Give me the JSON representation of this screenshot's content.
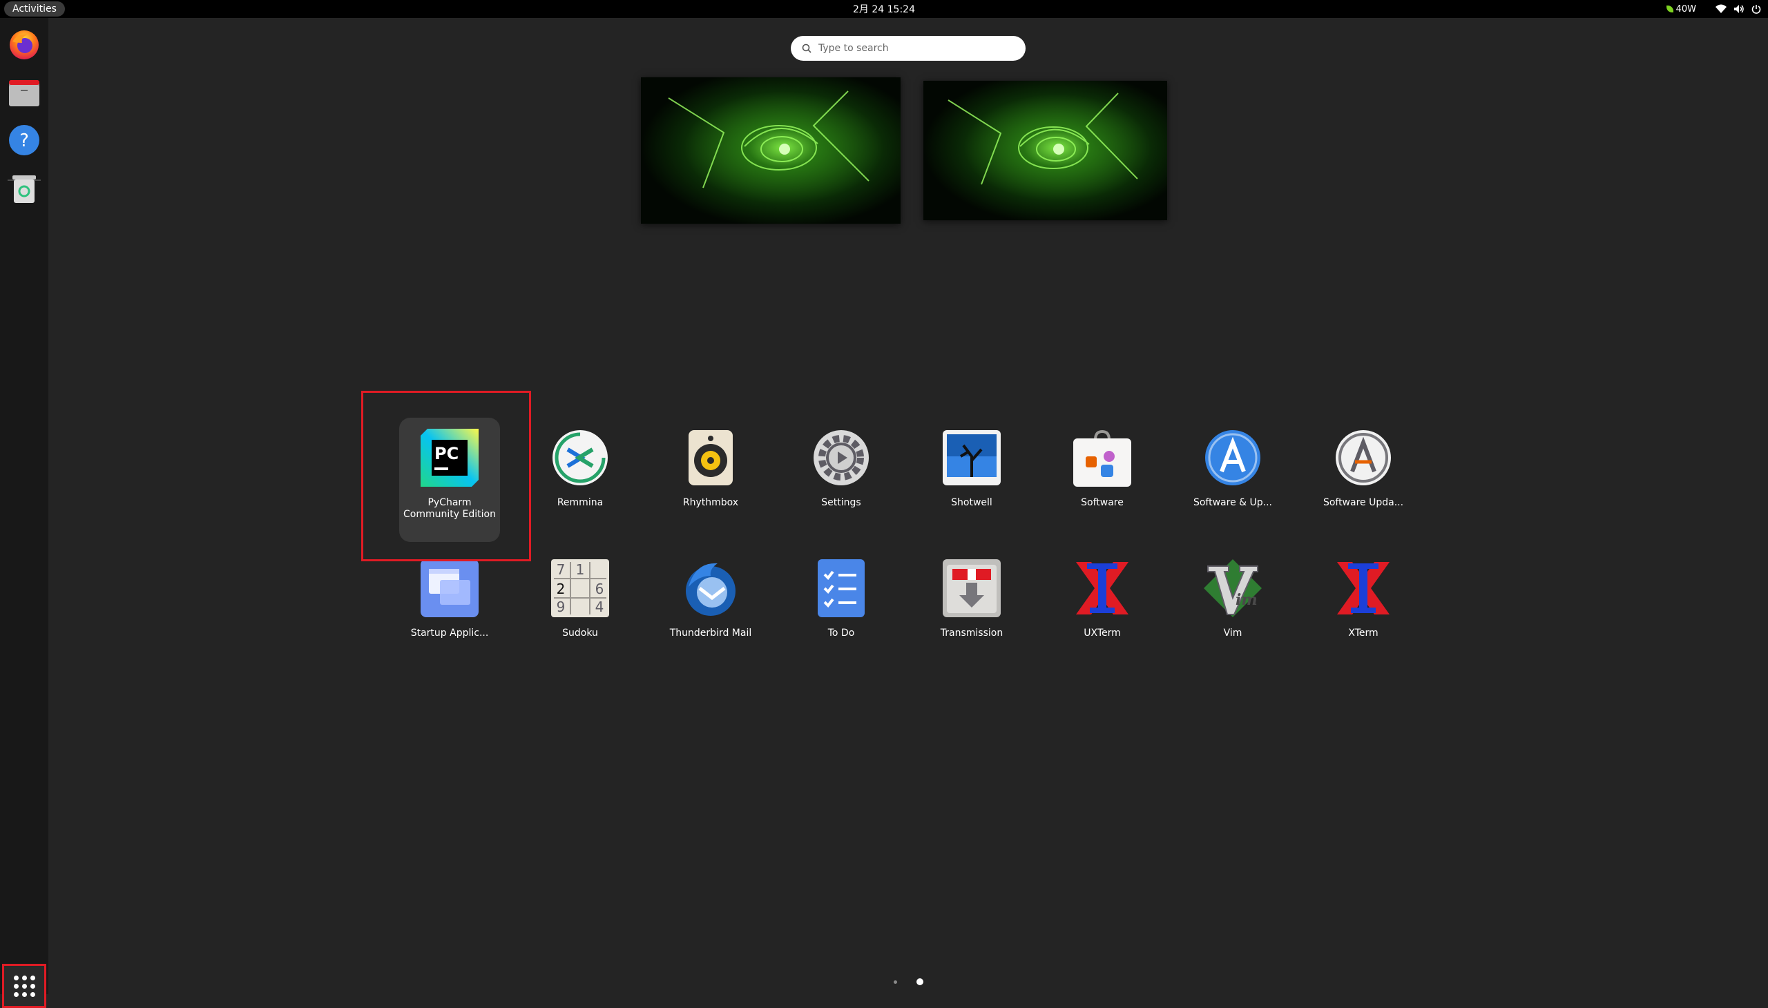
{
  "topbar": {
    "activities_label": "Activities",
    "clock": "2月 24  15:24",
    "power_rate": "40W"
  },
  "search": {
    "placeholder": "Type to search"
  },
  "apps": [
    {
      "label": "PyCharm Community Edition",
      "icon": "pycharm-icon",
      "selected": true
    },
    {
      "label": "Remmina",
      "icon": "remmina-icon"
    },
    {
      "label": "Rhythmbox",
      "icon": "rhythmbox-icon"
    },
    {
      "label": "Settings",
      "icon": "settings-gear-icon"
    },
    {
      "label": "Shotwell",
      "icon": "shotwell-icon"
    },
    {
      "label": "Software",
      "icon": "software-bag-icon"
    },
    {
      "label": "Software & Up...",
      "icon": "software-updates-icon"
    },
    {
      "label": "Software Upda...",
      "icon": "software-updater-icon"
    },
    {
      "label": "Startup Applic...",
      "icon": "startup-applications-icon"
    },
    {
      "label": "Sudoku",
      "icon": "sudoku-icon"
    },
    {
      "label": "Thunderbird Mail",
      "icon": "thunderbird-icon"
    },
    {
      "label": "To Do",
      "icon": "todo-checklist-icon"
    },
    {
      "label": "Transmission",
      "icon": "transmission-icon"
    },
    {
      "label": "UXTerm",
      "icon": "uxterm-x-icon"
    },
    {
      "label": "Vim",
      "icon": "vim-icon"
    },
    {
      "label": "XTerm",
      "icon": "xterm-x-icon"
    }
  ],
  "dock": [
    "firefox-icon",
    "files-icon",
    "help-icon",
    "trash-icon"
  ],
  "pager": {
    "pages": 2,
    "current": 2
  },
  "colors": {
    "highlight": "#e01b24",
    "background": "#242424"
  }
}
